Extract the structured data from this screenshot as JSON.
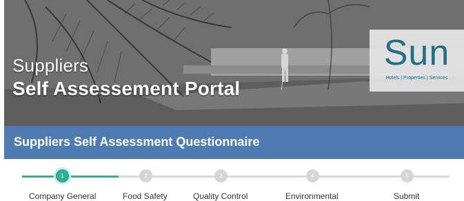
{
  "hero": {
    "title_line1": "Suppliers",
    "title_line2": "Self Assessement Portal"
  },
  "logo": {
    "wordmark": "Sun",
    "tagline": "Hotels | Properties | Services"
  },
  "banner": {
    "title": "Suppliers Self Assessment Questionnaire"
  },
  "steps": [
    {
      "number": "1",
      "label": "Company General",
      "active": true
    },
    {
      "number": "2",
      "label": "Food Safety",
      "active": false
    },
    {
      "number": "3",
      "label": "Quality Control",
      "active": false
    },
    {
      "number": "4",
      "label": "Environmental",
      "active": false
    },
    {
      "number": "5",
      "label": "Submit",
      "active": false
    }
  ],
  "colors": {
    "banner": "#4e7cb0",
    "accent": "#2bb39a",
    "logo_text": "#1f6f86"
  }
}
